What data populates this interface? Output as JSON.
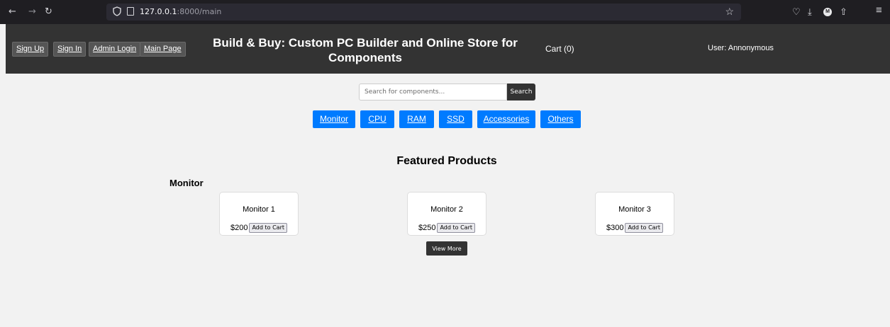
{
  "browser": {
    "back_icon": "←",
    "forward_icon": "→",
    "reload_icon": "↻",
    "url_host": "127.0.0.1",
    "url_rest": ":8000/main",
    "bookmark_icon": "☆",
    "pocket_icon": "♡",
    "download_icon": "⤓",
    "profile_initial": "M",
    "extensions_icon": "⇧",
    "menu_icon": "≡"
  },
  "header": {
    "buttons": [
      {
        "label": "Sign Up"
      },
      {
        "label": "Sign In"
      },
      {
        "label": "Admin Login"
      },
      {
        "label": "Main Page"
      }
    ],
    "title": "Build & Buy: Custom PC Builder and Online Store for Components",
    "cart": "Cart (0)",
    "user": "User: Annonymous"
  },
  "search": {
    "placeholder": "Search for components...",
    "button_label": "Search"
  },
  "categories": [
    {
      "label": "Monitor"
    },
    {
      "label": "CPU"
    },
    {
      "label": "RAM"
    },
    {
      "label": "SSD"
    },
    {
      "label": "Accessories"
    },
    {
      "label": "Others"
    }
  ],
  "featured": {
    "title": "Featured Products",
    "section_title": "Monitor",
    "products": [
      {
        "name": "Monitor 1",
        "price": "$200",
        "add_label": "Add to Cart"
      },
      {
        "name": "Monitor 2",
        "price": "$250",
        "add_label": "Add to Cart"
      },
      {
        "name": "Monitor 3",
        "price": "$300",
        "add_label": "Add to Cart"
      }
    ],
    "view_more": "View More"
  },
  "colors": {
    "header_bg": "#333333",
    "category_blue": "#007bff",
    "page_bg": "#f2f2f2"
  }
}
